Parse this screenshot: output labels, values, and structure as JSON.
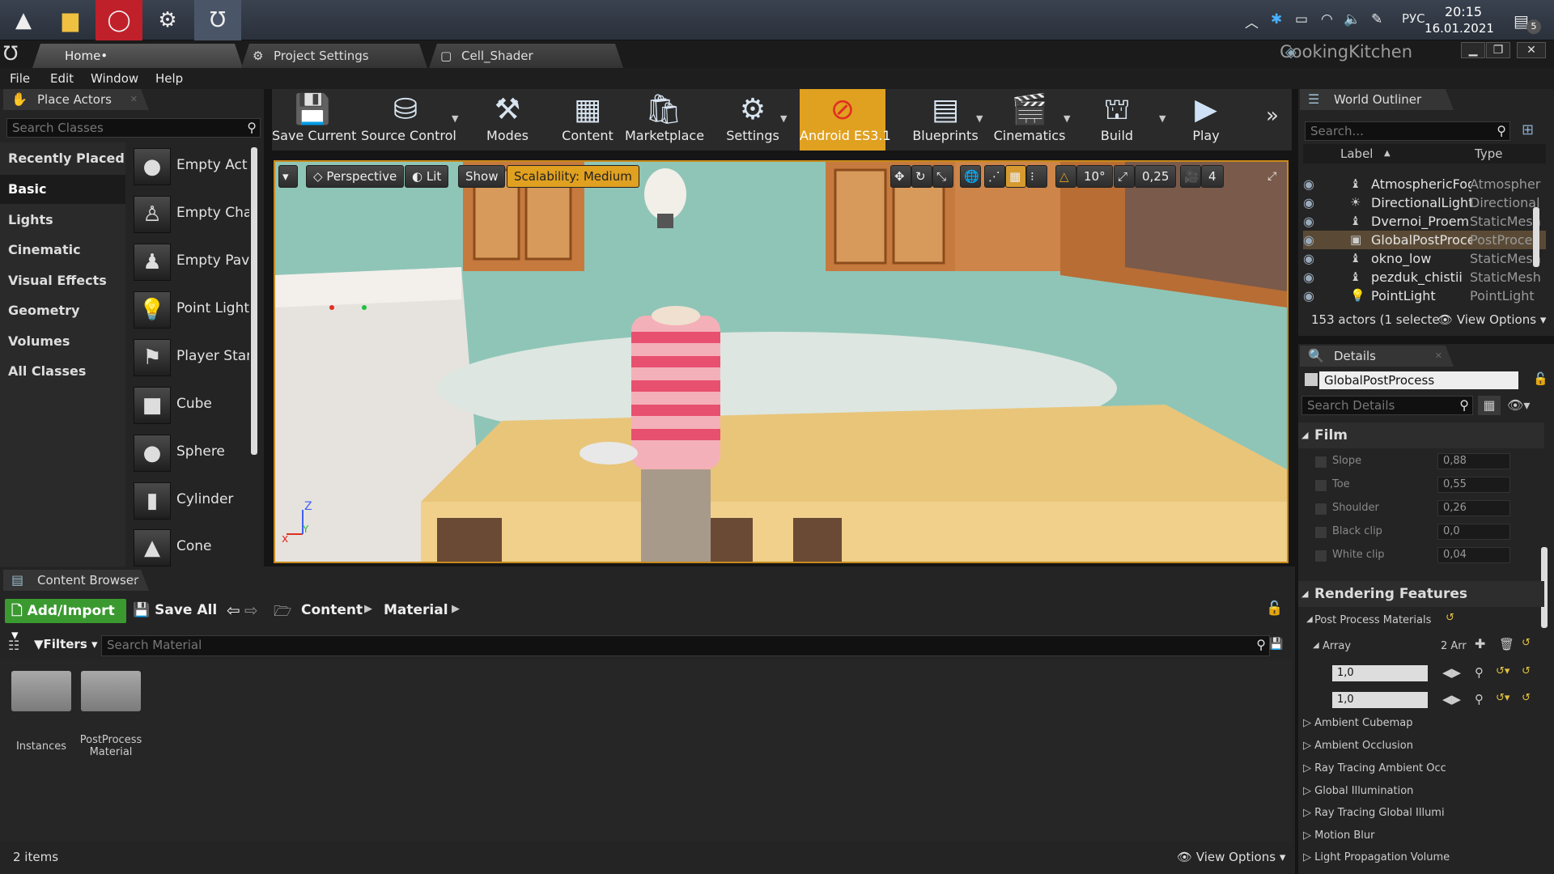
{
  "taskbar": {
    "tray": {
      "lang": "РУС",
      "time": "20:15",
      "date": "16.01.2021",
      "notif_count": "5"
    }
  },
  "titlebar": {
    "tabs": [
      {
        "label": "Home•"
      },
      {
        "label": "Project Settings"
      },
      {
        "label": "Cell_Shader"
      }
    ],
    "project": "CookingKitchen"
  },
  "menu": [
    "File",
    "Edit",
    "Window",
    "Help"
  ],
  "place_actors": {
    "tab": "Place Actors",
    "search_placeholder": "Search Classes",
    "categories": [
      "Recently Placed",
      "Basic",
      "Lights",
      "Cinematic",
      "Visual Effects",
      "Geometry",
      "Volumes",
      "All Classes"
    ],
    "actors": [
      "Empty Act",
      "Empty Cha",
      "Empty Pav",
      "Point Light",
      "Player Star",
      "Cube",
      "Sphere",
      "Cylinder",
      "Cone"
    ]
  },
  "toolbar": {
    "buttons": [
      "Save Current",
      "Source Control",
      "Modes",
      "Content",
      "Marketplace",
      "Settings",
      "Android ES3.1",
      "Blueprints",
      "Cinematics",
      "Build",
      "Play"
    ]
  },
  "viewport": {
    "perspective": "Perspective",
    "lit": "Lit",
    "show": "Show",
    "scalability": "Scalability: Medium",
    "angle": "10°",
    "scale": "0,25",
    "camera_speed": "4"
  },
  "outliner": {
    "tab": "World Outliner",
    "search_placeholder": "Search...",
    "col_label": "Label",
    "col_type": "Type",
    "rows": [
      {
        "name": "AtmosphericFog",
        "type": "Atmospher"
      },
      {
        "name": "DirectionalLight",
        "type": "Directional"
      },
      {
        "name": "Dvernoi_Proem",
        "type": "StaticMesh"
      },
      {
        "name": "GlobalPostProcess",
        "type": "PostProce"
      },
      {
        "name": "okno_low",
        "type": "StaticMesh"
      },
      {
        "name": "pezduk_chistii",
        "type": "StaticMesh"
      },
      {
        "name": "PointLight",
        "type": "PointLight"
      }
    ],
    "status": "153 actors (1 selecte",
    "view_options": "View Options"
  },
  "details": {
    "tab": "Details",
    "object_name": "GlobalPostProcess",
    "search_placeholder": "Search Details",
    "film": {
      "title": "Film",
      "props": [
        {
          "label": "Slope",
          "value": "0,88"
        },
        {
          "label": "Toe",
          "value": "0,55"
        },
        {
          "label": "Shoulder",
          "value": "0,26"
        },
        {
          "label": "Black clip",
          "value": "0,0"
        },
        {
          "label": "White clip",
          "value": "0,04"
        }
      ]
    },
    "rendering": {
      "title": "Rendering Features",
      "ppm": "Post Process Materials",
      "array": "Array",
      "array_count": "2 Arr",
      "weights": [
        "1,0",
        "1,0"
      ],
      "items": [
        "Ambient Cubemap",
        "Ambient Occlusion",
        "Ray Tracing Ambient Occ",
        "Global Illumination",
        "Ray Tracing Global Illumi",
        "Motion Blur",
        "Light Propagation Volume"
      ]
    }
  },
  "content_browser": {
    "tab": "Content Browser",
    "add_import": "Add/Import",
    "save_all": "Save All",
    "path": [
      "Content",
      "Material"
    ],
    "filters": "Filters",
    "search_placeholder": "Search Material",
    "folders": [
      "Instances",
      "PostProcess\nMaterial"
    ],
    "status": "2 items",
    "view_options": "View Options"
  }
}
